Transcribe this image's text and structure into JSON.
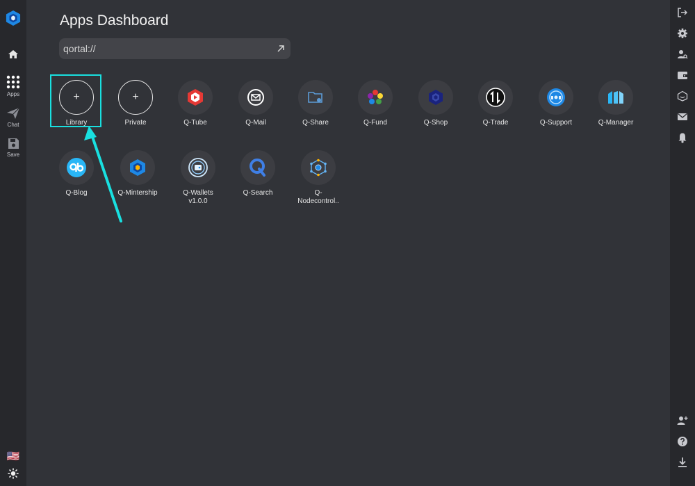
{
  "left_sidebar": {
    "logo_icon": "qortal-logo-icon",
    "items": [
      {
        "name": "home",
        "label": "",
        "icon": "home-icon"
      },
      {
        "name": "apps",
        "label": "Apps",
        "icon": "apps-grid-icon"
      },
      {
        "name": "chat",
        "label": "Chat",
        "icon": "send-icon"
      },
      {
        "name": "save",
        "label": "Save",
        "icon": "save-icon"
      }
    ],
    "bottom": {
      "flag": "🇺🇸",
      "theme_icon": "sun-icon"
    }
  },
  "main": {
    "title": "Apps Dashboard",
    "url_bar": {
      "value": "qortal://",
      "go_icon": "arrow-up-right-icon"
    },
    "apps": [
      {
        "name": "Library",
        "kind": "add"
      },
      {
        "name": "Private",
        "kind": "add"
      },
      {
        "name": "Q-Tube"
      },
      {
        "name": "Q-Mail"
      },
      {
        "name": "Q-Share"
      },
      {
        "name": "Q-Fund"
      },
      {
        "name": "Q-Shop"
      },
      {
        "name": "Q-Trade"
      },
      {
        "name": "Q-Support"
      },
      {
        "name": "Q-Manager"
      },
      {
        "name": "Q-Blog"
      },
      {
        "name": "Q-Mintership"
      },
      {
        "name": "Q-Wallets v1.0.0"
      },
      {
        "name": "Q-Search"
      },
      {
        "name": "Q-Nodecontrol.."
      }
    ],
    "add_symbol": "+"
  },
  "annotation": {
    "highlight_color": "#19e0e0",
    "target": "Library"
  },
  "right_sidebar": {
    "top_icons": [
      "logout-icon",
      "settings-gear-icon",
      "user-search-icon",
      "wallet-icon",
      "home-outline-icon",
      "mail-icon",
      "bell-icon"
    ],
    "bottom_icons": [
      "user-add-icon",
      "help-icon",
      "download-icon"
    ]
  },
  "colors": {
    "background": "#313338",
    "sidebar": "#27282c",
    "accent": "#19e0e0"
  }
}
